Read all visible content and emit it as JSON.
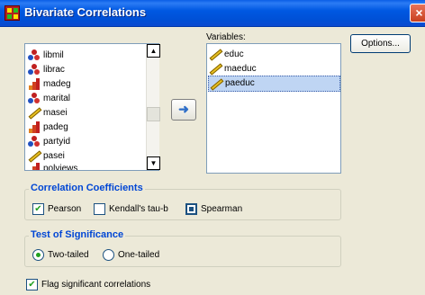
{
  "window": {
    "title": "Bivariate Correlations",
    "close_glyph": "×"
  },
  "source_list": {
    "items": [
      {
        "label": "libmil",
        "icon": "nominal-icon"
      },
      {
        "label": "librac",
        "icon": "nominal-icon"
      },
      {
        "label": "madeg",
        "icon": "ordinal-icon"
      },
      {
        "label": "marital",
        "icon": "nominal-icon"
      },
      {
        "label": "masei",
        "icon": "scale-icon"
      },
      {
        "label": "padeg",
        "icon": "ordinal-icon"
      },
      {
        "label": "partyid",
        "icon": "nominal-icon"
      },
      {
        "label": "pasei",
        "icon": "scale-icon"
      },
      {
        "label": "polviews",
        "icon": "ordinal-icon"
      }
    ],
    "scroll_up_glyph": "▲",
    "scroll_down_glyph": "▼"
  },
  "move_button": {
    "glyph": "➜"
  },
  "variables": {
    "label": "Variables:",
    "items": [
      {
        "label": "educ",
        "icon": "scale-icon",
        "selected": false
      },
      {
        "label": "maeduc",
        "icon": "scale-icon",
        "selected": false
      },
      {
        "label": "paeduc",
        "icon": "scale-icon",
        "selected": true
      }
    ]
  },
  "options_button": {
    "label": "Options..."
  },
  "correlation_coefficients": {
    "title": "Correlation Coefficients",
    "pearson": {
      "label": "Pearson",
      "checked": true,
      "check_glyph": "✔"
    },
    "kendall": {
      "label": "Kendall's tau-b",
      "checked": false
    },
    "spearman": {
      "label": "Spearman",
      "checked": false
    }
  },
  "test_of_significance": {
    "title": "Test of Significance",
    "two_tailed": {
      "label": "Two-tailed",
      "selected": true
    },
    "one_tailed": {
      "label": "One-tailed",
      "selected": false
    }
  },
  "flag": {
    "label": "Flag significant correlations",
    "checked": true,
    "check_glyph": "✔"
  },
  "colors": {
    "title_bar": "#0058e2",
    "group_title": "#0046d5",
    "check": "#21a121",
    "selection": "#bfd5f3"
  }
}
